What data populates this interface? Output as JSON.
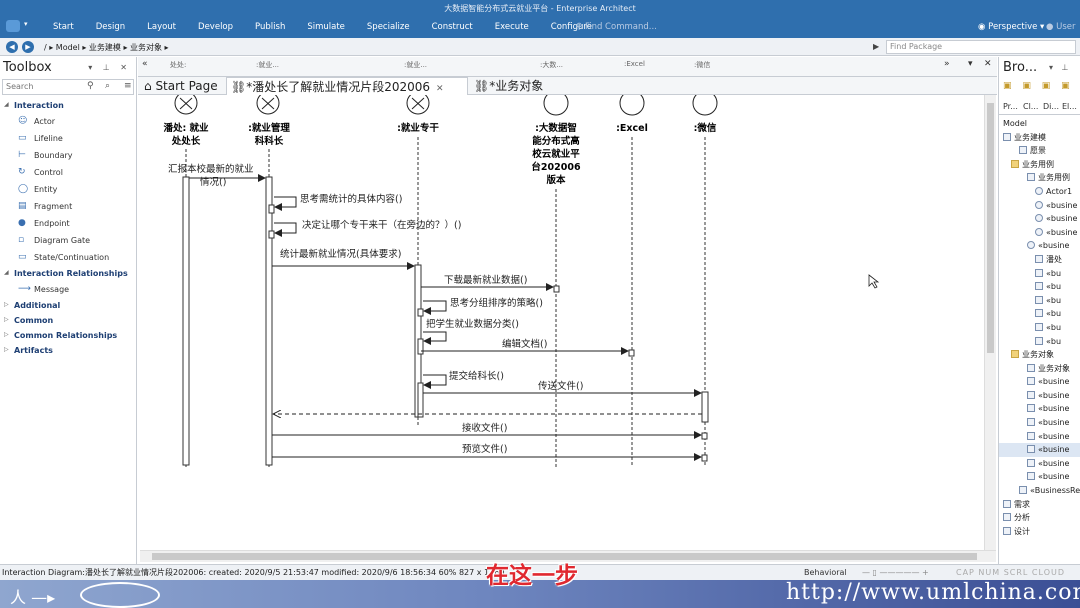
{
  "window_title": "大数据智能分布式云就业平台 - Enterprise Architect",
  "ribbon": {
    "menu": [
      "Start",
      "Design",
      "Layout",
      "Develop",
      "Publish",
      "Simulate",
      "Specialize",
      "Construct",
      "Execute",
      "Configure"
    ],
    "find_command": "Find Command...",
    "perspective": "Perspective",
    "user": "User"
  },
  "address": {
    "crumbs": "/  ▸ Model  ▸ 业务建模  ▸ 业务对象  ▸",
    "find_package_placeholder": "Find Package"
  },
  "toolbox": {
    "title": "Toolbox",
    "search_placeholder": "Search",
    "groups": [
      {
        "label": "Interaction",
        "items": [
          "Actor",
          "Lifeline",
          "Boundary",
          "Control",
          "Entity",
          "Fragment",
          "Endpoint",
          "Diagram Gate",
          "State/Continuation"
        ]
      },
      {
        "label": "Interaction Relationships",
        "items": [
          "Message"
        ]
      },
      {
        "label": "Additional",
        "items": []
      },
      {
        "label": "Common",
        "items": []
      },
      {
        "label": "Common Relationships",
        "items": []
      },
      {
        "label": "Artifacts",
        "items": []
      }
    ]
  },
  "column_headers": [
    "处处:",
    ":就业...",
    ":就业...",
    ":大数...",
    ":Excel",
    ":微信"
  ],
  "tabs": {
    "start": "Start Page",
    "active": "*潘处长了解就业情况片段202006",
    "other": "*业务对象"
  },
  "diagram": {
    "lifelines": [
      {
        "name": "潘处: 就业处处长",
        "lines": [
          "潘处: 就业",
          "处处长"
        ]
      },
      {
        "name": ":就业管理科科长",
        "lines": [
          ":就业管理",
          "科科长"
        ]
      },
      {
        "name": ":就业专干",
        "lines": [
          ":就业专干"
        ]
      },
      {
        "name": ":大数据智能分布式高校云就业平台202006版本",
        "lines": [
          ":大数据智",
          "能分布式高",
          "校云就业平",
          "台202006",
          "版本"
        ]
      },
      {
        "name": ":Excel",
        "lines": [
          ":Excel"
        ]
      },
      {
        "name": ":微信",
        "lines": [
          ":微信"
        ]
      }
    ],
    "messages": [
      {
        "text": "汇报本校最新的就业",
        "text2": "情况()"
      },
      {
        "text": "思考需统计的具体内容()"
      },
      {
        "text": "决定让哪个专干来干（在旁边的？）()"
      },
      {
        "text": "统计最新就业情况(具体要求)"
      },
      {
        "text": "下载最新就业数据()"
      },
      {
        "text": "思考分组排序的策略()"
      },
      {
        "text": "把学生就业数据分类()"
      },
      {
        "text": "编辑文档()"
      },
      {
        "text": "提交给科长()"
      },
      {
        "text": "传送文件()"
      },
      {
        "text": "接收文件()"
      },
      {
        "text": "预览文件()"
      }
    ]
  },
  "browser": {
    "title": "Bro...",
    "subtabs": [
      "Pr...",
      "Cl...",
      "Di...",
      "El..."
    ],
    "tree": [
      "Model",
      "业务建模",
      "愿景",
      "业务用例",
      "业务用例",
      "Actor1",
      "«busine",
      "«busine",
      "«busine",
      "«busine",
      "潘处",
      "«bu",
      "«bu",
      "«bu",
      "«bu",
      "«bu",
      "«bu",
      "业务对象",
      "业务对象",
      "«busine",
      "«busine",
      "«busine",
      "«busine",
      "«busine",
      "«busine",
      "«busine",
      "«busine",
      "«BusinessRe",
      "需求",
      "分析",
      "设计"
    ]
  },
  "status": {
    "left": "Interaction Diagram:潘处长了解就业情况片段202006:  created: 2020/9/5 21:53:47  modified: 2020/9/6 18:56:34   60%   827 x 1169",
    "behavioral": "Behavioral",
    "keys": "CAP  NUM  SCRL  CLOUD"
  },
  "subtitle": "在这一步",
  "watermark_url": "http://www.umlchina.com"
}
